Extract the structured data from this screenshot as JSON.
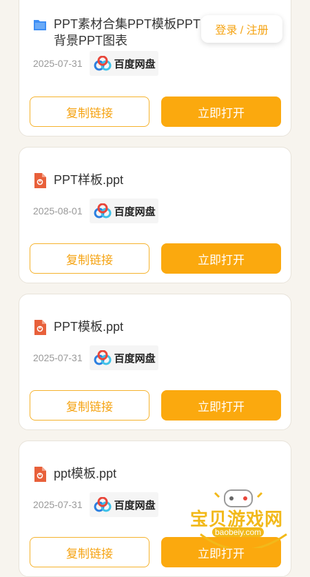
{
  "header": {
    "login_label": "登录 / 注册"
  },
  "files": [
    {
      "title": "PPT素材合集PPT模板PPT背景PPT图表",
      "date": "2025-07-31",
      "storage": "百度网盘",
      "copy_label": "复制链接",
      "open_label": "立即打开",
      "type": "folder"
    },
    {
      "title": "PPT样板.ppt",
      "date": "2025-08-01",
      "storage": "百度网盘",
      "copy_label": "复制链接",
      "open_label": "立即打开",
      "type": "ppt"
    },
    {
      "title": "PPT模板.ppt",
      "date": "2025-07-31",
      "storage": "百度网盘",
      "copy_label": "复制链接",
      "open_label": "立即打开",
      "type": "ppt"
    },
    {
      "title": "ppt模板.ppt",
      "date": "2025-07-31",
      "storage": "百度网盘",
      "copy_label": "复制链接",
      "open_label": "立即打开",
      "type": "ppt"
    }
  ],
  "watermark": {
    "title": "宝贝游戏网",
    "url": "baobeiy.com"
  },
  "colors": {
    "accent": "#fba90e",
    "outline": "#f5b12a",
    "folder": "#3d8ef5",
    "ppt": "#e8603a"
  }
}
